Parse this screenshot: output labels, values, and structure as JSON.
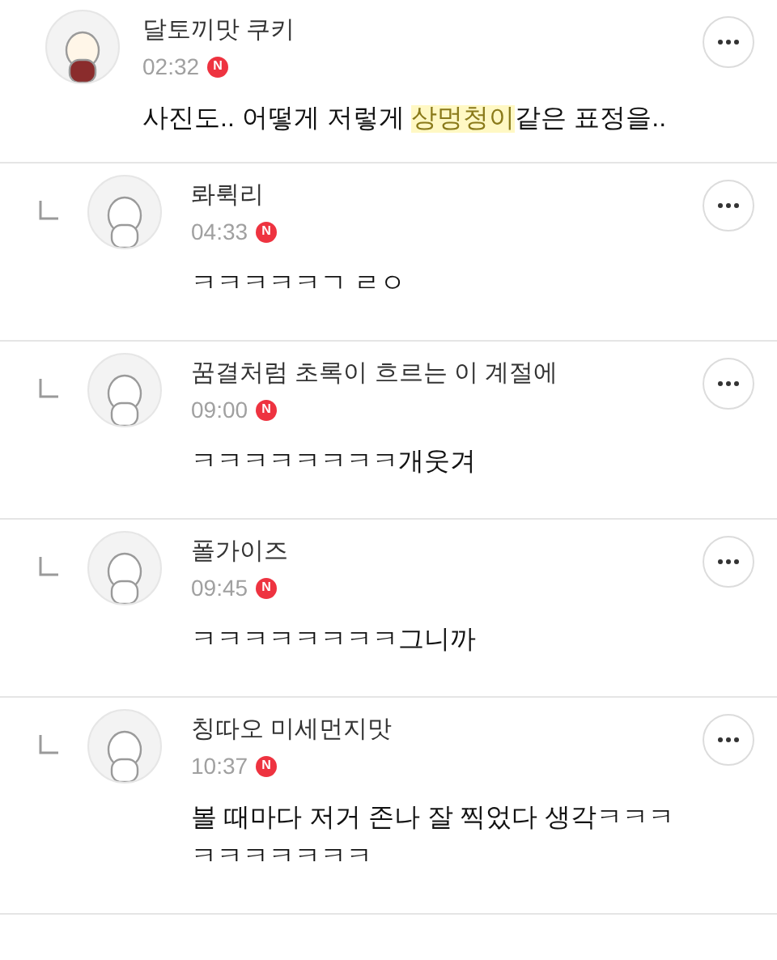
{
  "comments": [
    {
      "kind": "comment",
      "author": "달토끼맛 쿠키",
      "time": "02:32",
      "badge": "N",
      "body": [
        {
          "text": "사진도.. 어떻게 저렇게 ",
          "highlighted": false
        },
        {
          "text": "상멍청이",
          "highlighted": true
        },
        {
          "text": "같은 표정을..",
          "highlighted": false
        }
      ]
    },
    {
      "kind": "reply",
      "author": "롸뤽리",
      "time": "04:33",
      "badge": "N",
      "body": [
        {
          "text": "ㅋㅋㅋㅋㅋㄱ ㄹㅇ",
          "highlighted": false
        }
      ]
    },
    {
      "kind": "reply",
      "author": "꿈결처럼 초록이 흐르는 이 계절에",
      "time": "09:00",
      "badge": "N",
      "body": [
        {
          "text": "ㅋㅋㅋㅋㅋㅋㅋㅋ개웃겨",
          "highlighted": false
        }
      ]
    },
    {
      "kind": "reply",
      "author": "폴가이즈",
      "time": "09:45",
      "badge": "N",
      "body": [
        {
          "text": "ㅋㅋㅋㅋㅋㅋㅋㅋ그니까",
          "highlighted": false
        }
      ]
    },
    {
      "kind": "reply",
      "author": "칭따오 미세먼지맛",
      "time": "10:37",
      "badge": "N",
      "body": [
        {
          "text": "볼 때마다 저거 존나 잘 찍었다 생각ㅋㅋㅋㅋㅋㅋㅋㅋㅋㅋ",
          "highlighted": false
        }
      ]
    }
  ]
}
